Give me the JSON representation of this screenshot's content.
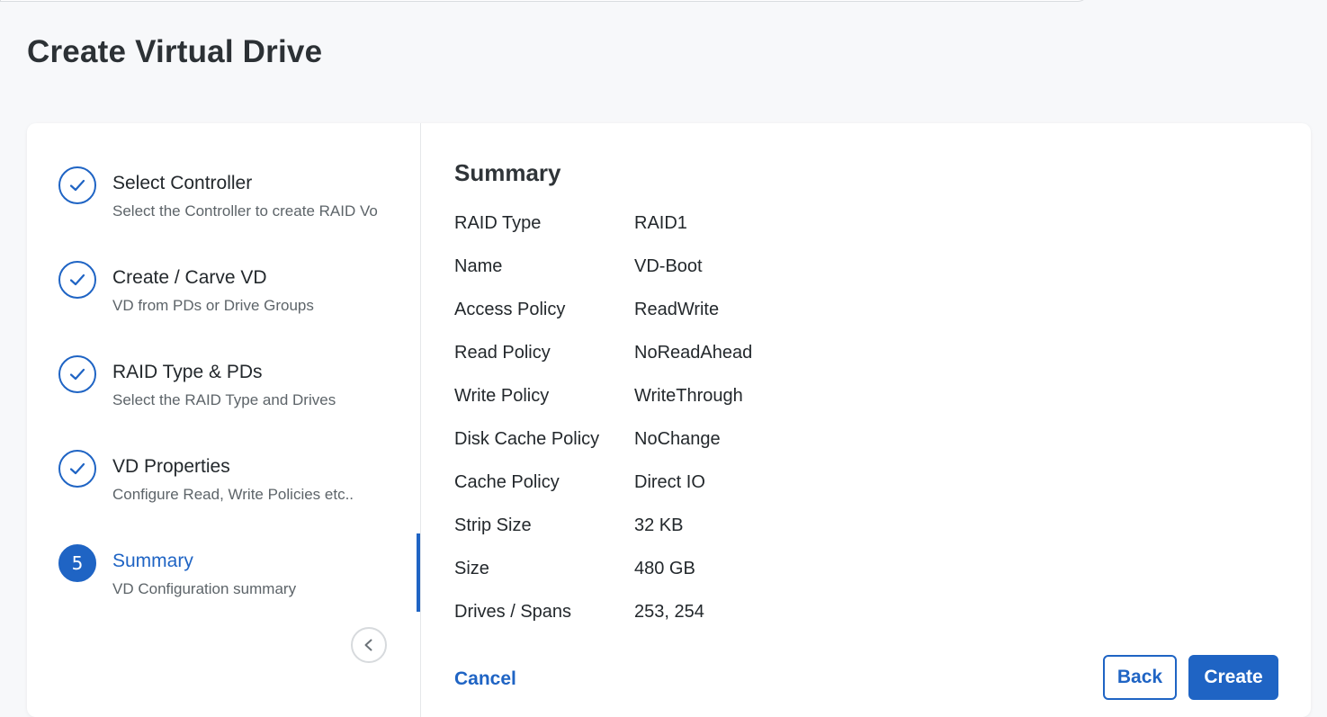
{
  "page": {
    "title": "Create Virtual Drive"
  },
  "wizard": {
    "steps": [
      {
        "title": "Select Controller",
        "subtitle": "Select the Controller to create RAID Vo",
        "status": "complete"
      },
      {
        "title": "Create / Carve VD",
        "subtitle": "VD from PDs or Drive Groups",
        "status": "complete"
      },
      {
        "title": "RAID Type & PDs",
        "subtitle": "Select the RAID Type and Drives",
        "status": "complete"
      },
      {
        "title": "VD Properties",
        "subtitle": "Configure Read, Write Policies etc..",
        "status": "complete"
      },
      {
        "number": "5",
        "title": "Summary",
        "subtitle": "VD Configuration summary",
        "status": "active"
      }
    ],
    "collapse_icon": "chevron-left-icon",
    "complete_icon": "check-icon"
  },
  "summary": {
    "heading": "Summary",
    "rows": [
      {
        "label": "RAID Type",
        "value": "RAID1"
      },
      {
        "label": "Name",
        "value": "VD-Boot"
      },
      {
        "label": "Access Policy",
        "value": "ReadWrite"
      },
      {
        "label": "Read Policy",
        "value": "NoReadAhead"
      },
      {
        "label": "Write Policy",
        "value": "WriteThrough"
      },
      {
        "label": "Disk Cache Policy",
        "value": "NoChange"
      },
      {
        "label": "Cache Policy",
        "value": "Direct IO"
      },
      {
        "label": "Strip Size",
        "value": "32 KB"
      },
      {
        "label": "Size",
        "value": "480 GB"
      },
      {
        "label": "Drives / Spans",
        "value": "253, 254"
      }
    ]
  },
  "actions": {
    "cancel_label": "Cancel",
    "back_label": "Back",
    "create_label": "Create"
  },
  "colors": {
    "accent": "#1f64c4",
    "text": "#23282c",
    "subtext": "#5d6469",
    "background": "#f7f8fa"
  }
}
